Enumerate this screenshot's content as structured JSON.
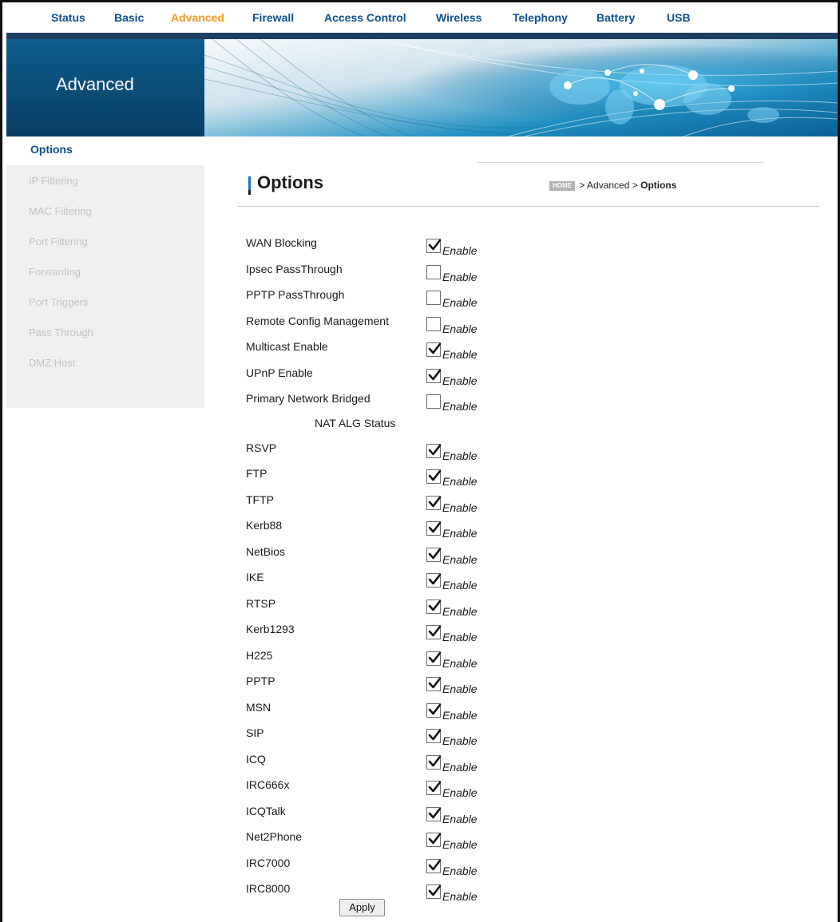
{
  "topnav": {
    "items": [
      {
        "label": "Status",
        "active": false
      },
      {
        "label": "Basic",
        "active": false
      },
      {
        "label": "Advanced",
        "active": true
      },
      {
        "label": "Firewall",
        "active": false
      },
      {
        "label": "Access Control",
        "active": false
      },
      {
        "label": "Wireless",
        "active": false
      },
      {
        "label": "Telephony",
        "active": false
      },
      {
        "label": "Battery",
        "active": false
      },
      {
        "label": "USB",
        "active": false
      }
    ]
  },
  "banner": {
    "title": "Advanced"
  },
  "sidebar": {
    "heading": "Options",
    "items": [
      "IP Filtering",
      "MAC Filtering",
      "Port Filtering",
      "Forwarding",
      "Port Triggers",
      "Pass Through",
      "DMZ Host"
    ]
  },
  "page": {
    "title": "Options",
    "breadcrumb": {
      "home": "HOME",
      "parent": "Advanced",
      "current": "Options",
      "separator": ">"
    }
  },
  "options": [
    {
      "label": "WAN Blocking",
      "checked": true,
      "enable_label": "Enable"
    },
    {
      "label": "Ipsec PassThrough",
      "checked": false,
      "enable_label": "Enable"
    },
    {
      "label": "PPTP PassThrough",
      "checked": false,
      "enable_label": "Enable"
    },
    {
      "label": "Remote Config Management",
      "checked": false,
      "enable_label": "Enable"
    },
    {
      "label": "Multicast Enable",
      "checked": true,
      "enable_label": "Enable"
    },
    {
      "label": "UPnP Enable",
      "checked": true,
      "enable_label": "Enable"
    },
    {
      "label": "Primary Network Bridged",
      "checked": false,
      "enable_label": "Enable"
    }
  ],
  "nat_alg": {
    "heading": "NAT ALG Status",
    "items": [
      {
        "label": "RSVP",
        "checked": true,
        "enable_label": "Enable"
      },
      {
        "label": "FTP",
        "checked": true,
        "enable_label": "Enable"
      },
      {
        "label": "TFTP",
        "checked": true,
        "enable_label": "Enable"
      },
      {
        "label": "Kerb88",
        "checked": true,
        "enable_label": "Enable"
      },
      {
        "label": "NetBios",
        "checked": true,
        "enable_label": "Enable"
      },
      {
        "label": "IKE",
        "checked": true,
        "enable_label": "Enable"
      },
      {
        "label": "RTSP",
        "checked": true,
        "enable_label": "Enable"
      },
      {
        "label": "Kerb1293",
        "checked": true,
        "enable_label": "Enable"
      },
      {
        "label": "H225",
        "checked": true,
        "enable_label": "Enable"
      },
      {
        "label": "PPTP",
        "checked": true,
        "enable_label": "Enable"
      },
      {
        "label": "MSN",
        "checked": true,
        "enable_label": "Enable"
      },
      {
        "label": "SIP",
        "checked": true,
        "enable_label": "Enable"
      },
      {
        "label": "ICQ",
        "checked": true,
        "enable_label": "Enable"
      },
      {
        "label": "IRC666x",
        "checked": true,
        "enable_label": "Enable"
      },
      {
        "label": "ICQTalk",
        "checked": true,
        "enable_label": "Enable"
      },
      {
        "label": "Net2Phone",
        "checked": true,
        "enable_label": "Enable"
      },
      {
        "label": "IRC7000",
        "checked": true,
        "enable_label": "Enable"
      },
      {
        "label": "IRC8000",
        "checked": true,
        "enable_label": "Enable"
      }
    ]
  },
  "actions": {
    "apply_label": "Apply"
  },
  "colors": {
    "nav_text": "#0d4f8c",
    "nav_active": "#f29a1e",
    "banner_dark": "#0a3e63",
    "sidebar_bg": "#efefef"
  }
}
